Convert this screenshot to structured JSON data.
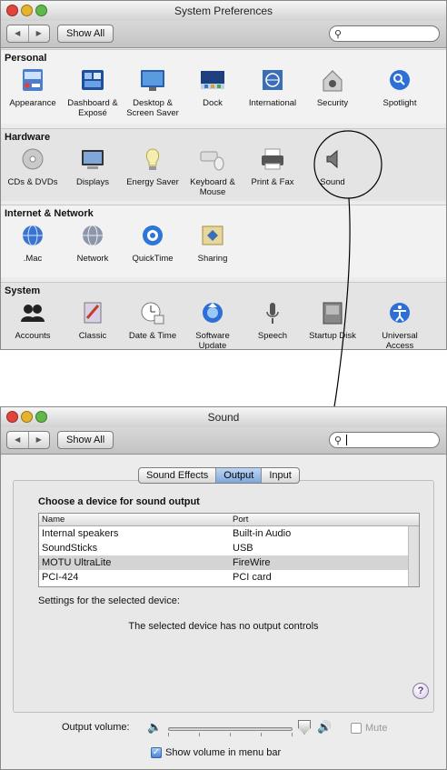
{
  "window1": {
    "title": "System Preferences",
    "show_all": "Show All",
    "search_value": "",
    "sections": [
      {
        "title": "Personal",
        "items": [
          {
            "label": "Appearance",
            "icon": "appearance-icon"
          },
          {
            "label": "Dashboard & Exposé",
            "icon": "dashboard-expose-icon"
          },
          {
            "label": "Desktop & Screen Saver",
            "icon": "desktop-icon"
          },
          {
            "label": "Dock",
            "icon": "dock-icon"
          },
          {
            "label": "International",
            "icon": "international-icon"
          },
          {
            "label": "Security",
            "icon": "security-icon"
          },
          {
            "label": "Spotlight",
            "icon": "spotlight-icon"
          }
        ]
      },
      {
        "title": "Hardware",
        "items": [
          {
            "label": "CDs & DVDs",
            "icon": "cd-dvd-icon"
          },
          {
            "label": "Displays",
            "icon": "displays-icon"
          },
          {
            "label": "Energy Saver",
            "icon": "energy-saver-icon"
          },
          {
            "label": "Keyboard & Mouse",
            "icon": "keyboard-mouse-icon"
          },
          {
            "label": "Print & Fax",
            "icon": "printer-icon"
          },
          {
            "label": "Sound",
            "icon": "sound-icon"
          }
        ]
      },
      {
        "title": "Internet & Network",
        "items": [
          {
            "label": ".Mac",
            "icon": "mac-globe-icon"
          },
          {
            "label": "Network",
            "icon": "network-icon"
          },
          {
            "label": "QuickTime",
            "icon": "quicktime-icon"
          },
          {
            "label": "Sharing",
            "icon": "sharing-icon"
          }
        ]
      },
      {
        "title": "System",
        "items": [
          {
            "label": "Accounts",
            "icon": "accounts-icon"
          },
          {
            "label": "Classic",
            "icon": "classic-icon"
          },
          {
            "label": "Date & Time",
            "icon": "date-time-icon"
          },
          {
            "label": "Software Update",
            "icon": "software-update-icon"
          },
          {
            "label": "Speech",
            "icon": "microphone-icon"
          },
          {
            "label": "Startup Disk",
            "icon": "startup-disk-icon"
          },
          {
            "label": "Universal Access",
            "icon": "universal-access-icon"
          }
        ]
      }
    ]
  },
  "window2": {
    "title": "Sound",
    "show_all": "Show All",
    "tabs": [
      {
        "label": "Sound Effects",
        "active": false
      },
      {
        "label": "Output",
        "active": true
      },
      {
        "label": "Input",
        "active": false
      }
    ],
    "chooser_title": "Choose a device for sound output",
    "columns": [
      "Name",
      "Port"
    ],
    "devices": [
      {
        "name": "Internal speakers",
        "port": "Built-in Audio",
        "selected": false
      },
      {
        "name": "SoundSticks",
        "port": "USB",
        "selected": false
      },
      {
        "name": "MOTU UltraLite",
        "port": "FireWire",
        "selected": true
      },
      {
        "name": "PCI-424",
        "port": "PCI card",
        "selected": false
      }
    ],
    "settings_label": "Settings for the selected device:",
    "no_controls": "The selected device has no output controls",
    "help": "?",
    "volume_label": "Output volume:",
    "volume_level": 1.0,
    "mute_label": "Mute",
    "mute_checked": false,
    "show_volume_label": "Show volume in menu bar",
    "show_volume_checked": true
  },
  "colors": {
    "red_light": "#e0443b",
    "yellow_light": "#e7b22d",
    "green_light": "#5fb84a",
    "accent": "#4c84d4"
  }
}
